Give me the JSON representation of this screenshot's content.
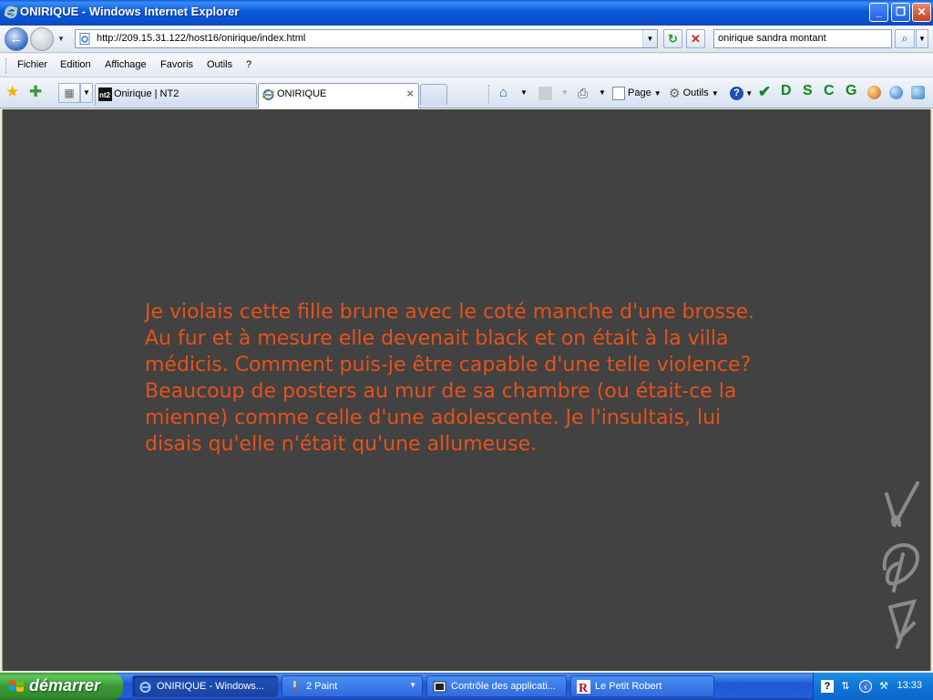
{
  "window": {
    "title": "ONIRIQUE - Windows Internet Explorer",
    "minimize_glyph": "_",
    "maximize_glyph": "❐",
    "close_glyph": "✕"
  },
  "address_bar": {
    "url": "http://209.15.31.122/host16/onirique/index.html",
    "back_glyph": "←",
    "forward_glyph": "→",
    "refresh_glyph": "↻",
    "stop_glyph": "✕"
  },
  "search": {
    "value": "onirique sandra montant",
    "button_glyph": "⌕"
  },
  "menu": {
    "items": [
      "Fichier",
      "Edition",
      "Affichage",
      "Favoris",
      "Outils",
      "?"
    ]
  },
  "tabs": [
    {
      "label": "Onirique | NT2",
      "icon": "nt2-icon",
      "active": false
    },
    {
      "label": "ONIRIQUE",
      "icon": "ie-page-icon",
      "active": true
    }
  ],
  "tab_close_glyph": "×",
  "command_bar": {
    "page_label": "Page",
    "tools_label": "Outils",
    "help_glyph": "?",
    "letters": [
      "D",
      "S",
      "C",
      "G"
    ],
    "check_glyph": "✔"
  },
  "content": {
    "background": "#424242",
    "text_color": "#e5521a",
    "text": "Je violais cette fille brune avec le coté manche d'une brosse. Au fur et à mesure elle devenait black et on était à la villa médicis. Comment puis-je être capable d'une telle violence? Beaucoup de posters au mur de sa chambre (ou était-ce la mienne) comme celle d'une adolescente. Je l'insultais, lui disais qu'elle n'était qu'une allumeuse."
  },
  "taskbar": {
    "start_label": "démarrer",
    "tasks": [
      {
        "label": "ONIRIQUE - Windows...",
        "icon": "ie-icon",
        "active": true
      },
      {
        "label": "2 Paint",
        "icon": "paint-icon",
        "active": false
      },
      {
        "label": "Contrôle des applicati...",
        "icon": "control-icon",
        "active": false
      },
      {
        "label": "Le Petit Robert",
        "icon": "robert-icon",
        "active": false
      }
    ],
    "clock": "13:33"
  }
}
